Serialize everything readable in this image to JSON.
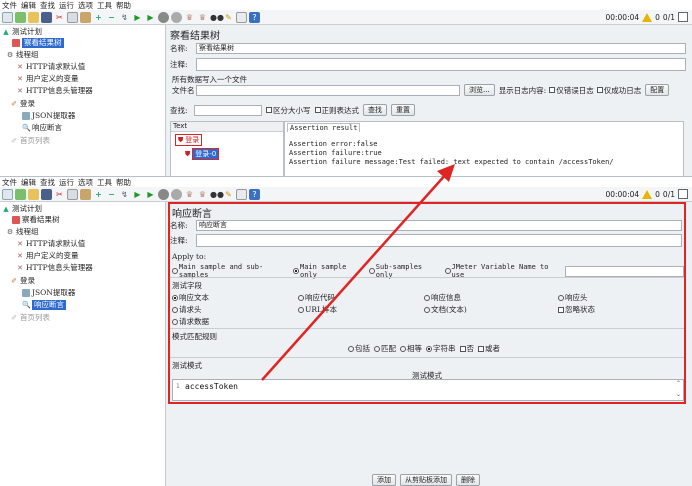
{
  "menu": [
    "文件",
    "编辑",
    "查找",
    "运行",
    "选项",
    "工具",
    "帮助"
  ],
  "timer": "00:00:04",
  "warn_count": "0",
  "threads": "0/1",
  "top": {
    "tree": {
      "test_plan": "测试计划",
      "results_tree": "察看结果树",
      "thread_group": "线程组",
      "http_defaults": "HTTP请求默认值",
      "user_vars": "用户定义的变量",
      "http_header": "HTTP信息头管理器",
      "login": "登录",
      "json_extractor": "JSON提取器",
      "assertion": "响应断言",
      "home": "首页列表"
    },
    "panel": {
      "title": "察看结果树",
      "name_label": "名称:",
      "name_value": "察看结果树",
      "comment_label": "注释:",
      "write_all": "所有数据写入一个文件",
      "filename_label": "文件名",
      "browse": "浏览...",
      "log_content": "显示日志内容:",
      "errors_only": "仅错误日志",
      "success_only": "仅成功日志",
      "configure": "配置",
      "search_label": "查找:",
      "case_sensitive": "区分大小写",
      "regex": "正则表达式",
      "find_btn": "查找",
      "reset_btn": "重置",
      "col_text": "Text",
      "tab_assertion": "Assertion result",
      "sample_login": "登录",
      "sample_child": "登录-0",
      "result_lines": [
        "Assertion error:false",
        "Assertion failure:true",
        "Assertion failure message:Test failed: text expected to contain /accessToken/"
      ]
    }
  },
  "bottom": {
    "tree": {
      "test_plan": "测试计划",
      "results_tree": "察看结果树",
      "thread_group": "线程组",
      "http_defaults": "HTTP请求默认值",
      "user_vars": "用户定义的变量",
      "http_header": "HTTP信息头管理器",
      "login": "登录",
      "json_extractor": "JSON提取器",
      "assertion": "响应断言",
      "home": "首页列表"
    },
    "panel": {
      "title": "响应断言",
      "name_label": "名称:",
      "name_value": "响应断言",
      "comment_label": "注释:",
      "apply_to": "Apply to:",
      "apply_opts": [
        "Main sample and sub-samples",
        "Main sample only",
        "Sub-samples only",
        "JMeter Variable Name to use"
      ],
      "field_label": "测试字段",
      "fields": [
        "响应文本",
        "响应代码",
        "响应信息",
        "响应头",
        "请求头",
        "URL样本",
        "文档(文本)",
        "忽略状态",
        "请求数据"
      ],
      "rule_label": "模式匹配规则",
      "rules": [
        "包括",
        "匹配",
        "相等",
        "字符串",
        "否",
        "或者"
      ],
      "pattern_label": "测试模式",
      "pattern_header": "测试模式",
      "pattern_row": "1",
      "pattern_value": "accessToken",
      "add_btn": "添加",
      "clip_btn": "从剪贴板添加",
      "del_btn": "删除"
    }
  },
  "colors": {
    "accent": "#2d6ad0",
    "annotation": "#e02424"
  }
}
